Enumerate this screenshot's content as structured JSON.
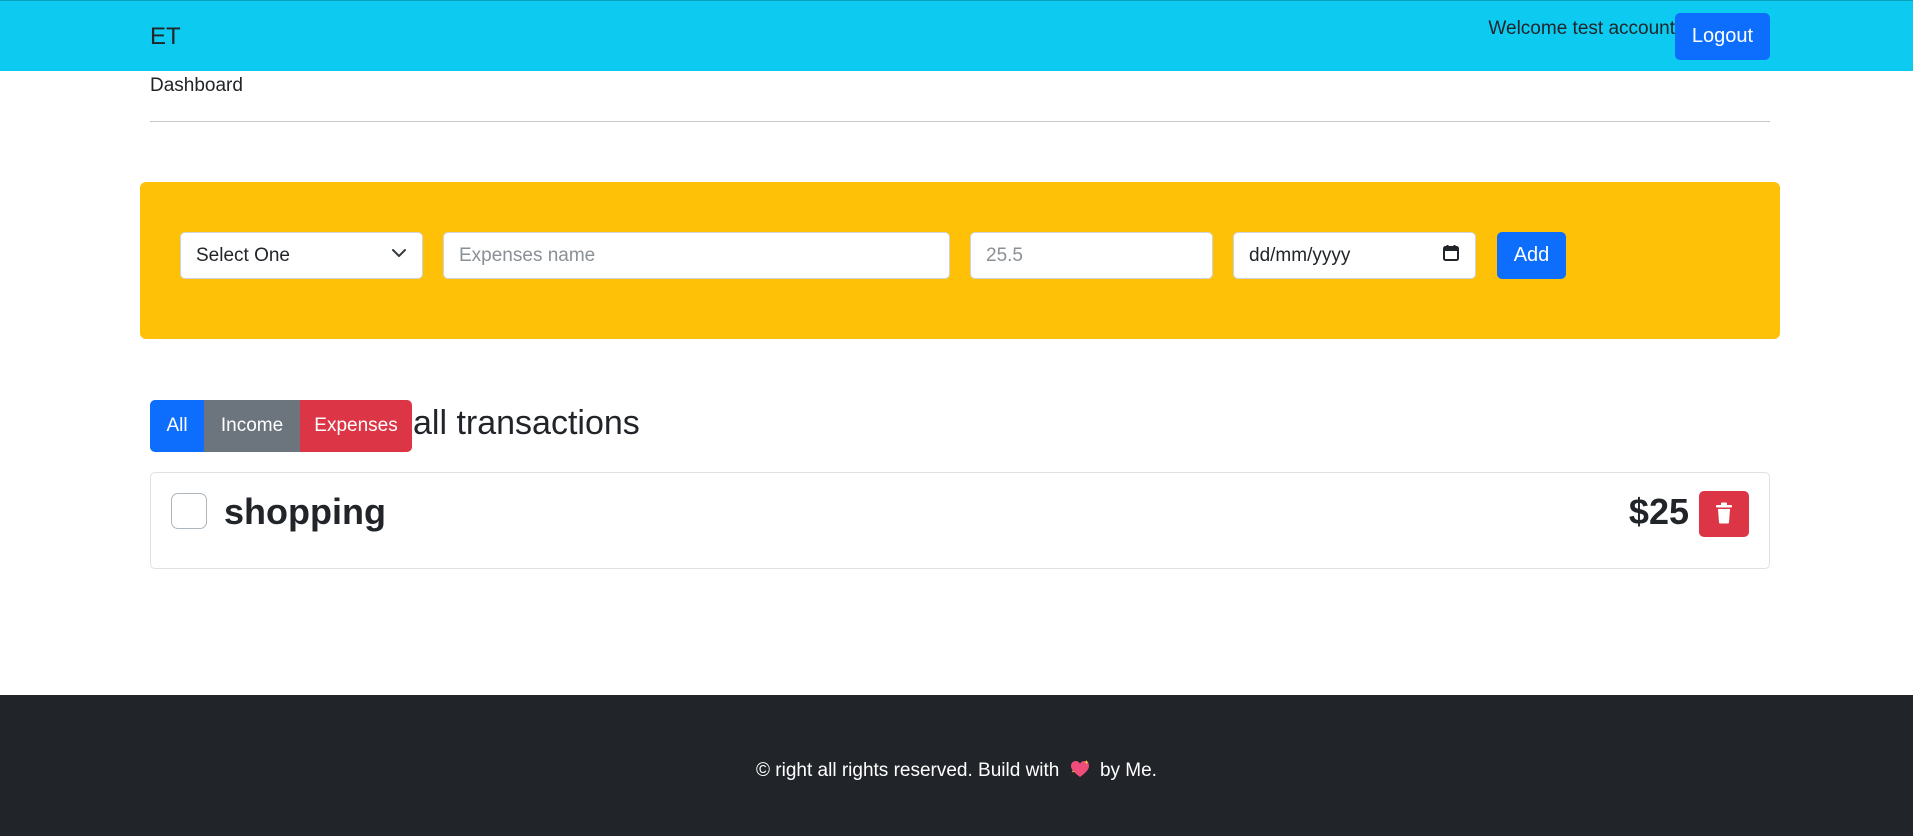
{
  "header": {
    "brand": "ET",
    "welcome": "Welcome test account",
    "logout_label": "Logout"
  },
  "nav": {
    "dashboard": "Dashboard"
  },
  "form": {
    "type_select": {
      "selected": "Select One"
    },
    "name_input": {
      "placeholder": "Expenses name",
      "value": ""
    },
    "amount_input": {
      "placeholder": "25.5",
      "value": ""
    },
    "date_input": {
      "placeholder": "dd/mm/yyyy",
      "value": ""
    },
    "add_label": "Add"
  },
  "filters": {
    "all_label": "All",
    "income_label": "Income",
    "expenses_label": "Expenses"
  },
  "section_title": "all transactions",
  "transactions": [
    {
      "name": "shopping",
      "amount": "$25",
      "checked": false
    }
  ],
  "footer": {
    "text_before": "© right all rights reserved. Build with",
    "text_after": "by Me.",
    "icon": "sparkling-heart-icon"
  },
  "colors": {
    "navbar": "#0dcaf0",
    "primary": "#0d6efd",
    "secondary": "#6c757d",
    "danger": "#dc3545",
    "warning": "#ffc107",
    "dark": "#212529"
  }
}
